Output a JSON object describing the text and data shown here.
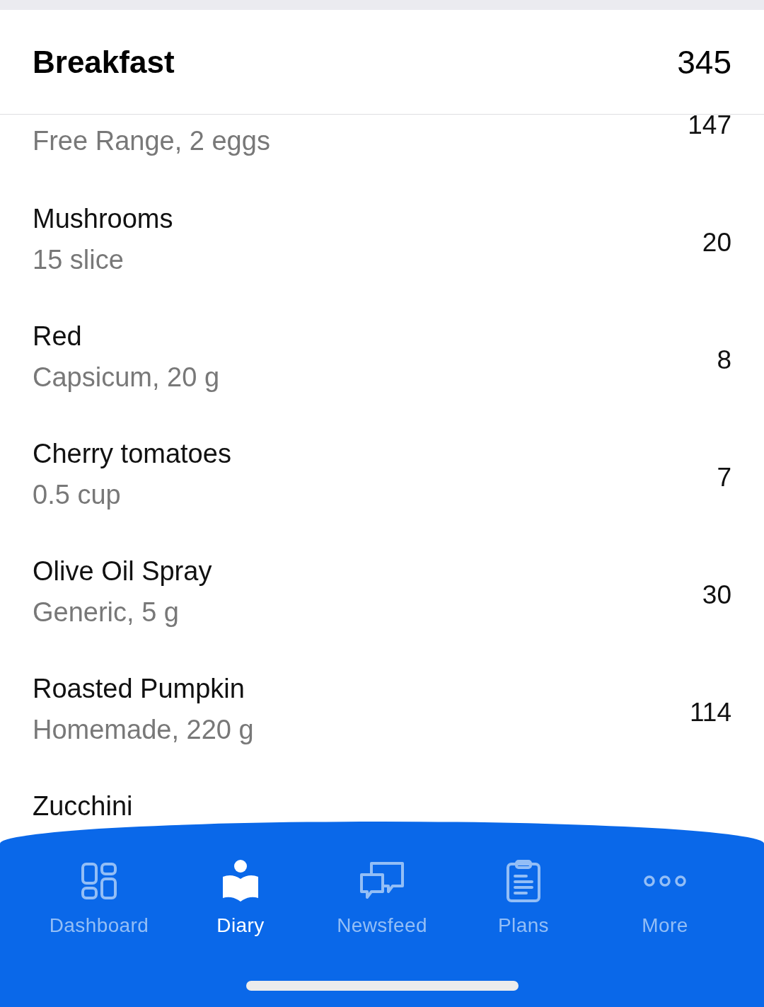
{
  "header": {
    "title": "Breakfast",
    "calories": "345"
  },
  "entries": [
    {
      "detail": "Free Range, 2 eggs",
      "calories": "147"
    },
    {
      "name": "Mushrooms",
      "detail": "15 slice",
      "calories": "20"
    },
    {
      "name": "Red",
      "detail": "Capsicum, 20 g",
      "calories": "8"
    },
    {
      "name": "Cherry tomatoes",
      "detail": "0.5 cup",
      "calories": "7"
    },
    {
      "name": "Olive Oil Spray",
      "detail": "Generic, 5 g",
      "calories": "30"
    },
    {
      "name": "Roasted Pumpkin",
      "detail": "Homemade, 220 g",
      "calories": "114"
    },
    {
      "name": "Zucchini"
    }
  ],
  "tab_bar": {
    "tabs": [
      {
        "label": "Dashboard",
        "kind": "dashboard",
        "selected": false
      },
      {
        "label": "Diary",
        "kind": "diary",
        "selected": true
      },
      {
        "label": "Newsfeed",
        "kind": "newsfeed",
        "selected": false
      },
      {
        "label": "Plans",
        "kind": "plans",
        "selected": false
      },
      {
        "label": "More",
        "kind": "more",
        "selected": false
      }
    ]
  }
}
